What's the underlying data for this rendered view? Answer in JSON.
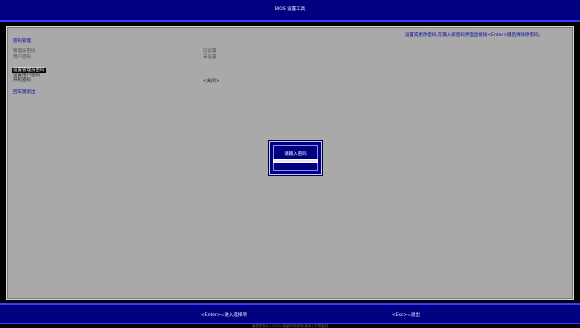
{
  "window": {
    "title": "BIOS 设置工具"
  },
  "help_text": "设置或更改密码,在输入新密码界面直接按<Enter>键后清除原密码。",
  "section": {
    "title": "密码管理"
  },
  "status_rows": [
    {
      "label": "管理员密码",
      "value": "已设置"
    },
    {
      "label": "用户密码",
      "value": "未设置"
    }
  ],
  "menu": {
    "admin_password": "设置管理员密码",
    "user_password": "设置用户密码",
    "power_on_password": "开机密码",
    "power_on_value": "<关闭>",
    "exit": "回车键退出"
  },
  "dialog": {
    "prompt": "请输入密码",
    "value": ""
  },
  "footer": {
    "enter_hint": "<Enter>=进入选择项",
    "esc_hint": "<Esc>=退出"
  },
  "copyright": "版权所有(C) 2021 保留所有权利(版本)  不得复制"
}
